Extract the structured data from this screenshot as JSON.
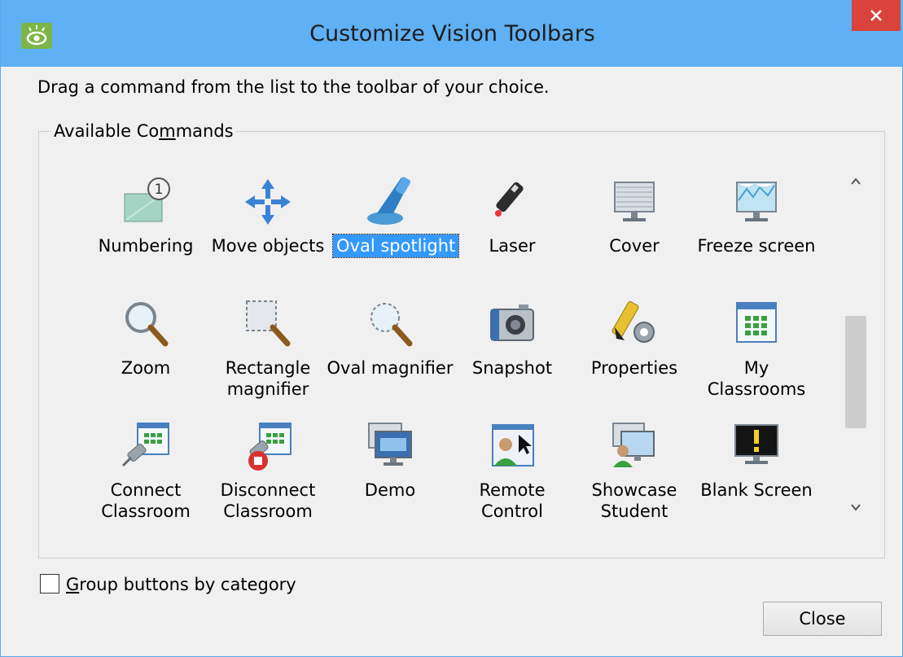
{
  "window": {
    "title": "Customize Vision Toolbars",
    "close_icon": "x-icon",
    "app_icon": "eye-icon",
    "title_bar_color": "#5fb0f4",
    "close_color": "#d9433b"
  },
  "instructions": "Drag a command from the list to the toolbar of your choice.",
  "available_commands": {
    "legend_pre": "Available Co",
    "legend_mnemonic": "m",
    "legend_post": "mands",
    "selected": "Oval spotlight",
    "selection_color": "#3399ff",
    "rows": [
      [
        {
          "label": "Numbering",
          "icon": "numbering-icon"
        },
        {
          "label": "Move objects",
          "icon": "move-objects-icon"
        },
        {
          "label": "Oval spotlight",
          "icon": "oval-spotlight-icon"
        },
        {
          "label": "Laser",
          "icon": "laser-icon"
        },
        {
          "label": "Cover",
          "icon": "cover-icon"
        },
        {
          "label": "Freeze screen",
          "icon": "freeze-screen-icon"
        }
      ],
      [
        {
          "label": "Zoom",
          "icon": "zoom-icon"
        },
        {
          "label": "Rectangle magnifier",
          "icon": "rectangle-magnifier-icon"
        },
        {
          "label": "Oval magnifier",
          "icon": "oval-magnifier-icon"
        },
        {
          "label": "Snapshot",
          "icon": "snapshot-icon"
        },
        {
          "label": "Properties",
          "icon": "properties-icon"
        },
        {
          "label": "My Classrooms",
          "icon": "my-classrooms-icon"
        }
      ],
      [
        {
          "label": "Connect Classroom",
          "icon": "connect-classroom-icon"
        },
        {
          "label": "Disconnect Classroom",
          "icon": "disconnect-classroom-icon"
        },
        {
          "label": "Demo",
          "icon": "demo-icon"
        },
        {
          "label": "Remote Control",
          "icon": "remote-control-icon"
        },
        {
          "label": "Showcase Student",
          "icon": "showcase-student-icon"
        },
        {
          "label": "Blank Screen",
          "icon": "blank-screen-icon"
        }
      ]
    ]
  },
  "group_option": {
    "label_mnemonic": "G",
    "label_rest": "roup buttons by category",
    "checked": false
  },
  "buttons": {
    "close": "Close"
  }
}
